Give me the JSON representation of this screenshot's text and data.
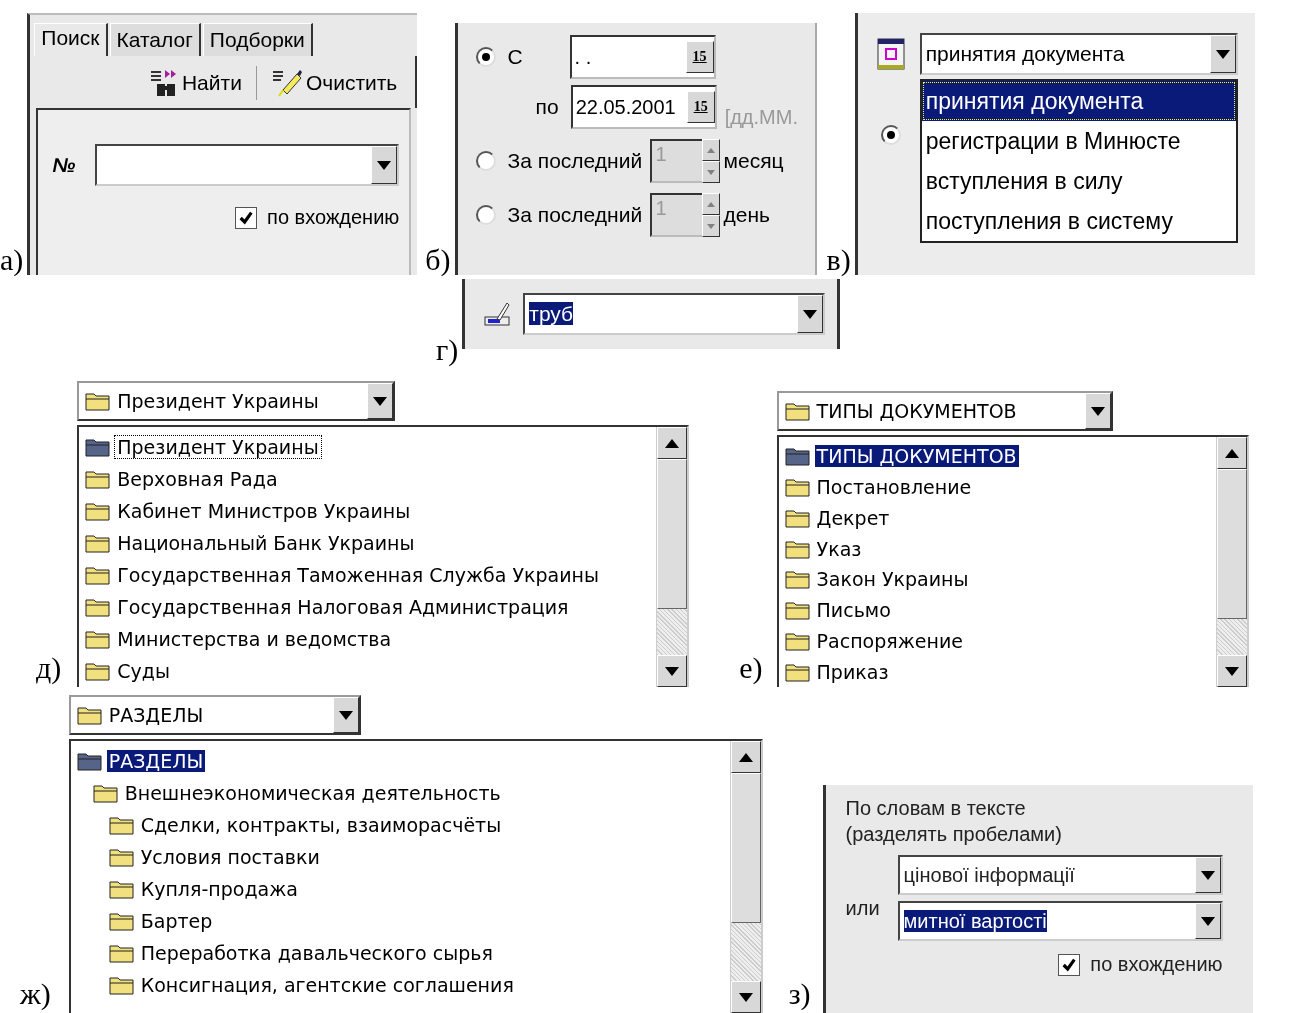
{
  "figure_a": {
    "label": "а)",
    "tabs": [
      {
        "label": "Поиск",
        "selected": true
      },
      {
        "label": "Каталог",
        "selected": false
      },
      {
        "label": "Подборки",
        "selected": false
      }
    ],
    "toolbar": [
      {
        "kind": "find",
        "label": "Найти"
      },
      {
        "kind": "clear",
        "label": "Очистить"
      }
    ],
    "number_label": "№",
    "match_checkbox": {
      "label": "по вхождению",
      "checked": true
    }
  },
  "figure_b": {
    "label": "б)",
    "date_range": {
      "selected": true,
      "from_label": "С",
      "from_value": ". .",
      "from_calendar": "15",
      "to_label": "по",
      "to_value": "22.05.2001",
      "to_calendar": "15",
      "format_hint": "[дд.ММ."
    },
    "periods": [
      {
        "label": "За последний",
        "value": "1",
        "disabled": true,
        "unit": "месяц",
        "selected": false
      },
      {
        "label": "За последний",
        "value": "1",
        "disabled": true,
        "unit": "день",
        "selected": false
      }
    ]
  },
  "figure_v": {
    "label": "в)",
    "combo_value": "принятия документа",
    "radio_selected": true,
    "options": [
      {
        "label": "принятия документа",
        "selected": true
      },
      {
        "label": "регистрации в Минюсте",
        "selected": false
      },
      {
        "label": "вступления в силу",
        "selected": false
      },
      {
        "label": "поступления в систему",
        "selected": false
      }
    ]
  },
  "figure_g": {
    "label": "г)",
    "value": "труб",
    "highlighted": true
  },
  "figure_d": {
    "label": "д)",
    "combo_value": "Президент Украины",
    "list_focused": false,
    "items": [
      {
        "label": "Президент Украины",
        "selected": true
      },
      {
        "label": "Верховная Рада",
        "selected": false
      },
      {
        "label": "Кабинет Министров Украины",
        "selected": false
      },
      {
        "label": "Национальный Банк Украины",
        "selected": false
      },
      {
        "label": "Государственная Таможенная Служба Украины",
        "selected": false
      },
      {
        "label": "Государственная Налоговая Администрация",
        "selected": false
      },
      {
        "label": "Министерства и ведомства",
        "selected": false
      },
      {
        "label": "Суды",
        "selected": false
      }
    ]
  },
  "figure_e": {
    "label": "е)",
    "combo_value": "ТИПЫ ДОКУМЕНТОВ",
    "list_focused": true,
    "items": [
      {
        "label": "ТИПЫ ДОКУМЕНТОВ",
        "selected": true
      },
      {
        "label": "Постановление",
        "selected": false
      },
      {
        "label": "Декрет",
        "selected": false
      },
      {
        "label": "Указ",
        "selected": false
      },
      {
        "label": "Закон Украины",
        "selected": false
      },
      {
        "label": "Письмо",
        "selected": false
      },
      {
        "label": "Распоряжение",
        "selected": false
      },
      {
        "label": "Приказ",
        "selected": false
      }
    ]
  },
  "figure_zh": {
    "label": "ж)",
    "combo_value": "РАЗДЕЛЫ",
    "list_focused": true,
    "items": [
      {
        "label": "РАЗДЕЛЫ",
        "selected": true,
        "children": [
          {
            "label": "Внешнеэкономическая деятельность",
            "selected": false,
            "children": [
              {
                "label": "Сделки, контракты, взаиморасчёты",
                "selected": false
              },
              {
                "label": "Условия поставки",
                "selected": false
              },
              {
                "label": "Купля-продажа",
                "selected": false
              },
              {
                "label": "Бартер",
                "selected": false
              },
              {
                "label": "Переработка давальческого сырья",
                "selected": false
              },
              {
                "label": "Консигнация, агентские соглашения",
                "selected": false
              }
            ]
          }
        ]
      }
    ]
  },
  "figure_z": {
    "label": "з)",
    "title": "По словам в тексте\n(разделять пробелами)",
    "or_label": "или",
    "fields": [
      {
        "value": "цінової інформації",
        "highlighted": false
      },
      {
        "value": "митної вартості",
        "highlighted": true
      }
    ],
    "match_checkbox": {
      "label": "по вхождению",
      "checked": true
    }
  }
}
